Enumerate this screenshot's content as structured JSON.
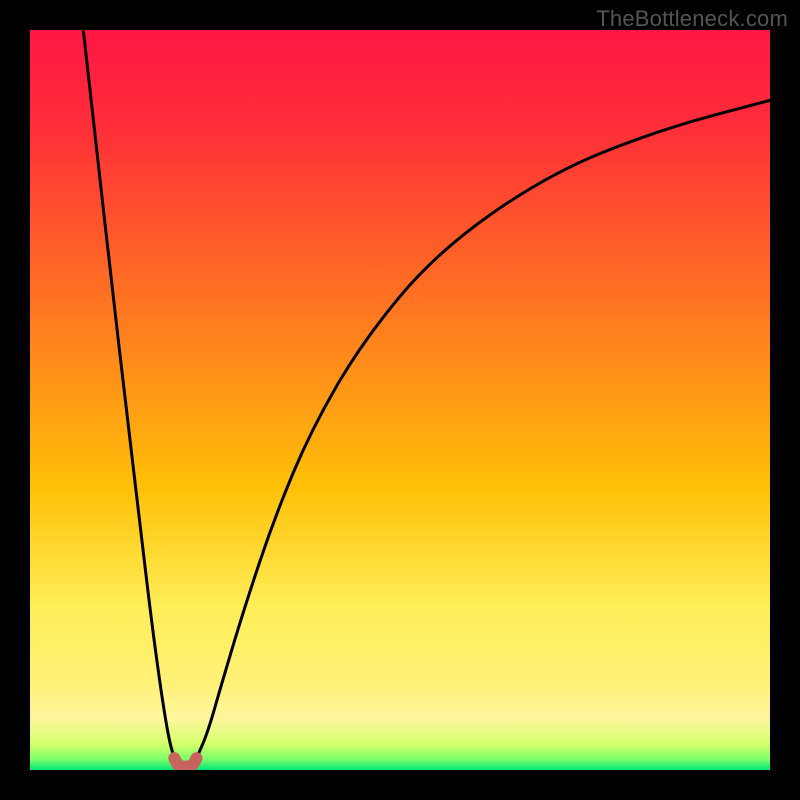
{
  "watermark": "TheBottleneck.com",
  "chart_data": {
    "type": "line",
    "title": "",
    "xlabel": "",
    "ylabel": "",
    "xlim": [
      0,
      1
    ],
    "ylim": [
      0,
      1
    ],
    "gradient_stops": [
      {
        "offset": 0.0,
        "color": "#ff1744"
      },
      {
        "offset": 0.12,
        "color": "#ff2b3a"
      },
      {
        "offset": 0.28,
        "color": "#ff5a2a"
      },
      {
        "offset": 0.45,
        "color": "#ff8c1a"
      },
      {
        "offset": 0.62,
        "color": "#ffc107"
      },
      {
        "offset": 0.78,
        "color": "#ffee58"
      },
      {
        "offset": 0.88,
        "color": "#fff176"
      },
      {
        "offset": 0.93,
        "color": "#fff59d"
      },
      {
        "offset": 0.965,
        "color": "#d4ff6a"
      },
      {
        "offset": 0.985,
        "color": "#7dff6a"
      },
      {
        "offset": 1.0,
        "color": "#00e676"
      }
    ],
    "series": [
      {
        "name": "left-branch",
        "x": [
          0.072,
          0.09,
          0.11,
          0.13,
          0.15,
          0.165,
          0.178,
          0.188,
          0.195
        ],
        "y": [
          1.0,
          0.84,
          0.66,
          0.49,
          0.32,
          0.195,
          0.1,
          0.04,
          0.016
        ]
      },
      {
        "name": "right-branch",
        "x": [
          0.225,
          0.24,
          0.26,
          0.29,
          0.33,
          0.38,
          0.45,
          0.55,
          0.7,
          0.85,
          1.0
        ],
        "y": [
          0.016,
          0.05,
          0.12,
          0.22,
          0.34,
          0.46,
          0.58,
          0.7,
          0.805,
          0.865,
          0.905
        ]
      },
      {
        "name": "valley-marker",
        "x": [
          0.195,
          0.2,
          0.21,
          0.22,
          0.225
        ],
        "y": [
          0.016,
          0.006,
          0.004,
          0.006,
          0.016
        ]
      }
    ],
    "valley_marker_color": "#c8645e",
    "curve_color": "#000000"
  }
}
